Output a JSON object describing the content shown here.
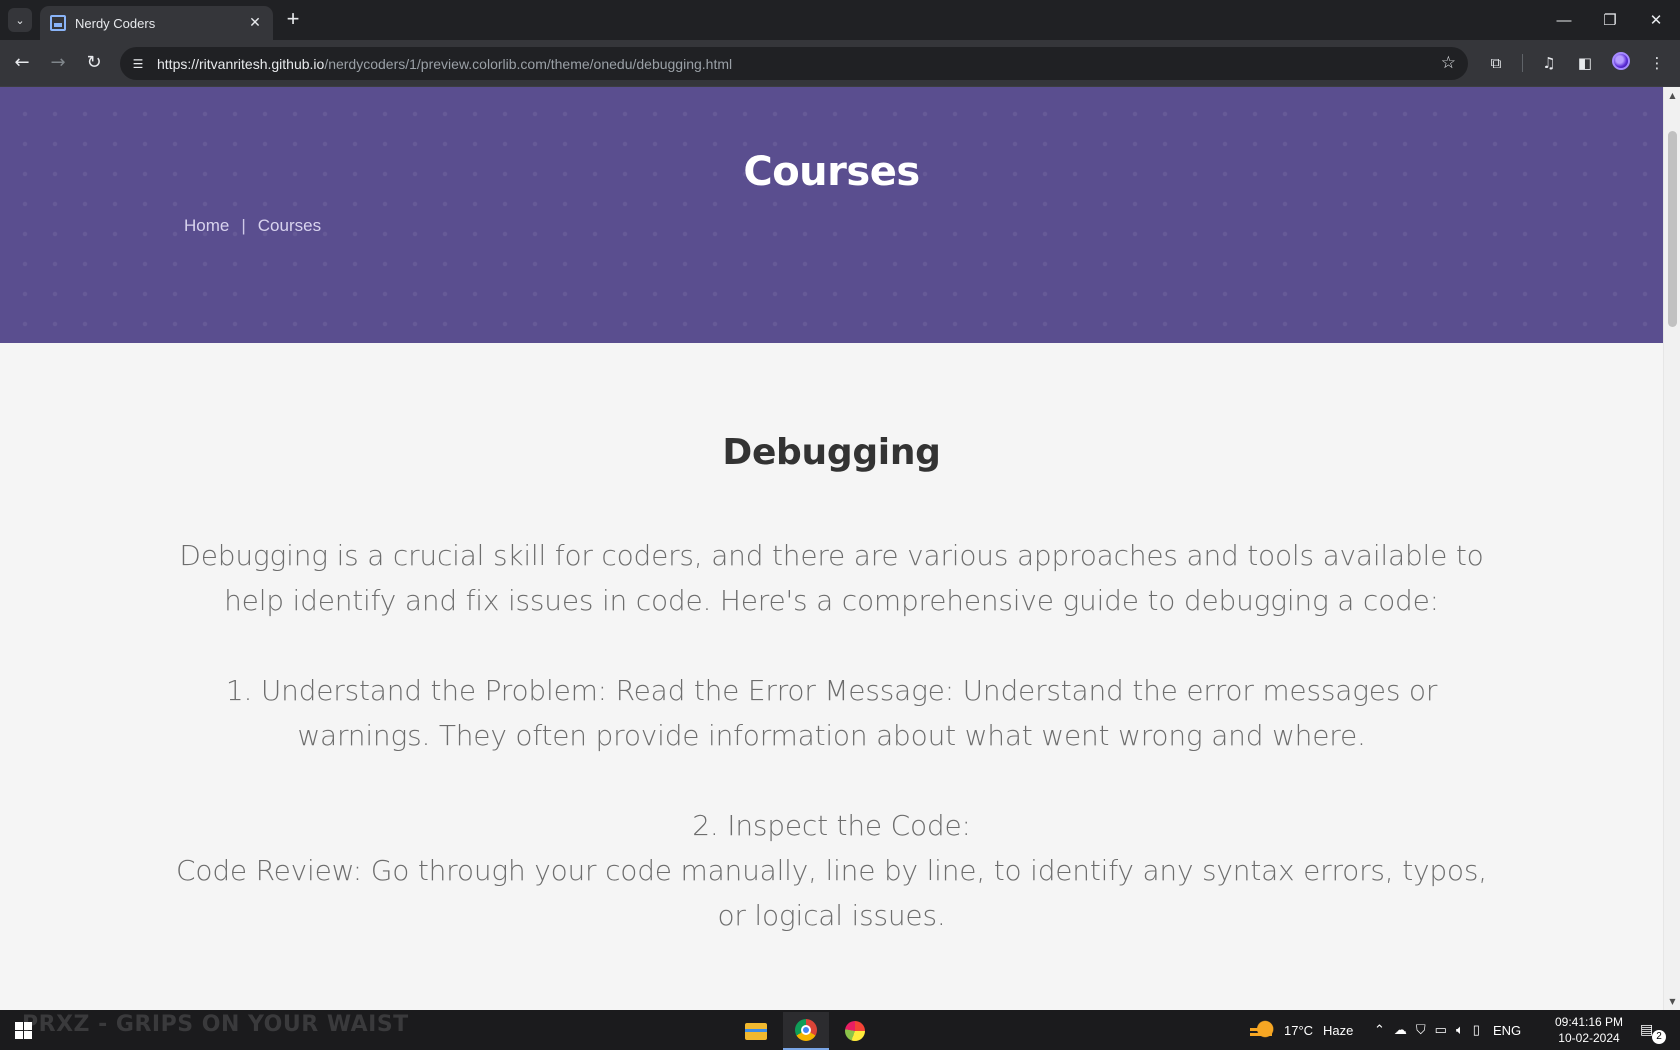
{
  "browser": {
    "tab_title": "Nerdy Coders",
    "url_host": "https://ritvanritesh.github.io",
    "url_path": "/nerdycoders/1/preview.colorlib.com/theme/onedu/debugging.html"
  },
  "hero": {
    "title": "Courses",
    "breadcrumb": [
      "Home",
      "|",
      "Courses"
    ]
  },
  "content": {
    "title": "Debugging",
    "paragraphs": [
      "Debugging is a crucial skill for coders, and there are various approaches and tools available to help identify and fix issues in code. Here's a comprehensive guide to debugging a code:",
      "1. Understand the Problem: Read the Error Message: Understand the error messages or warnings. They often provide information about what went wrong and where.",
      "2. Inspect the Code:",
      "Code Review: Go through your code manually, line by line, to identify any syntax errors, typos, or logical issues."
    ]
  },
  "taskbar": {
    "wallpaper_text": "PRXZ - GRIPS ON YOUR WAIST",
    "weather_temp": "17°C",
    "weather_desc": "Haze",
    "language": "ENG",
    "time": "09:41:16 PM",
    "date": "10-02-2024",
    "notification_count": "2"
  },
  "colors": {
    "hero_bg": "#5a4e8f",
    "page_bg": "#f5f5f5",
    "title_text": "#333333",
    "body_text": "#6d6d6d"
  }
}
